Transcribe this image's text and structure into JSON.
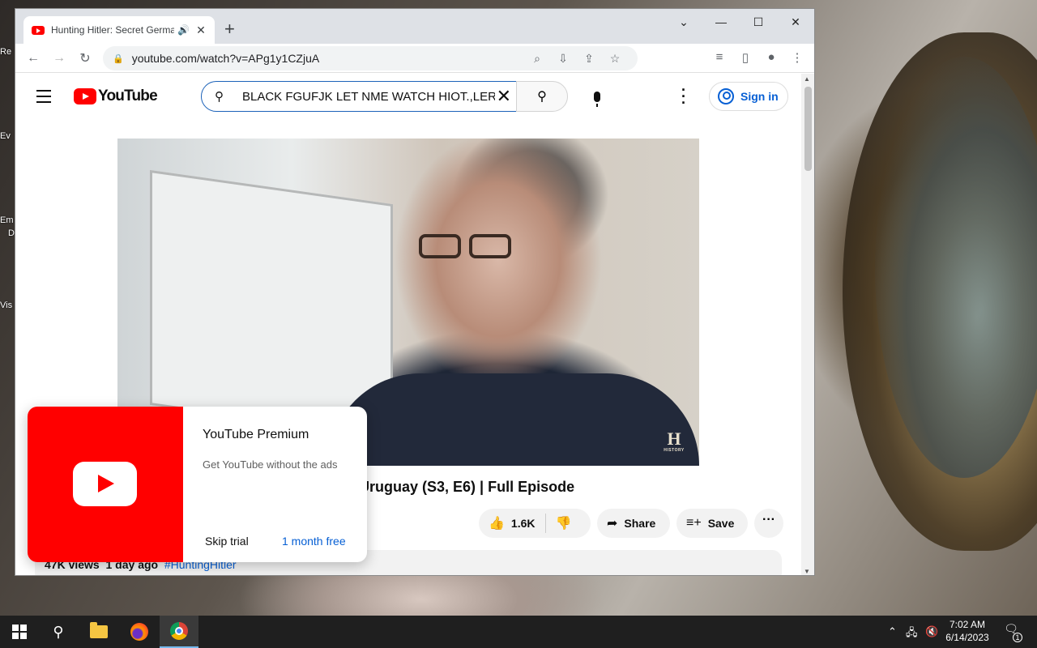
{
  "browser": {
    "tab_title": "Hunting Hitler: Secret Germa",
    "url": "youtube.com/watch?v=APg1y1CZjuA"
  },
  "youtube": {
    "logo_text": "YouTube",
    "search_query": "BLACK FGUFJK LET NME WATCH HIOT.,LER",
    "signin_label": "Sign in",
    "video_title": "Uruguay (S3, E6) | Full Episode",
    "video_title_prefix": "",
    "watermark": "H",
    "watermark_sub": "HISTORY",
    "like_count": "1.6K",
    "share_label": "Share",
    "save_label": "Save",
    "views": "47K views",
    "age": "1 day ago",
    "hashtag": "#HuntingHitler"
  },
  "premium_popup": {
    "title": "YouTube Premium",
    "subtitle": "Get YouTube without the ads",
    "skip_label": "Skip trial",
    "cta_label": "1 month free"
  },
  "taskbar": {
    "time": "7:02 AM",
    "date": "6/14/2023",
    "notification_count": "1"
  },
  "desktop": {
    "icon_labels": [
      "Re",
      "Ev",
      "Em",
      "D",
      "Vis"
    ]
  },
  "colors": {
    "youtube_red": "#ff0000",
    "link_blue": "#065fd4",
    "taskbar_bg": "#1f1f1f"
  }
}
